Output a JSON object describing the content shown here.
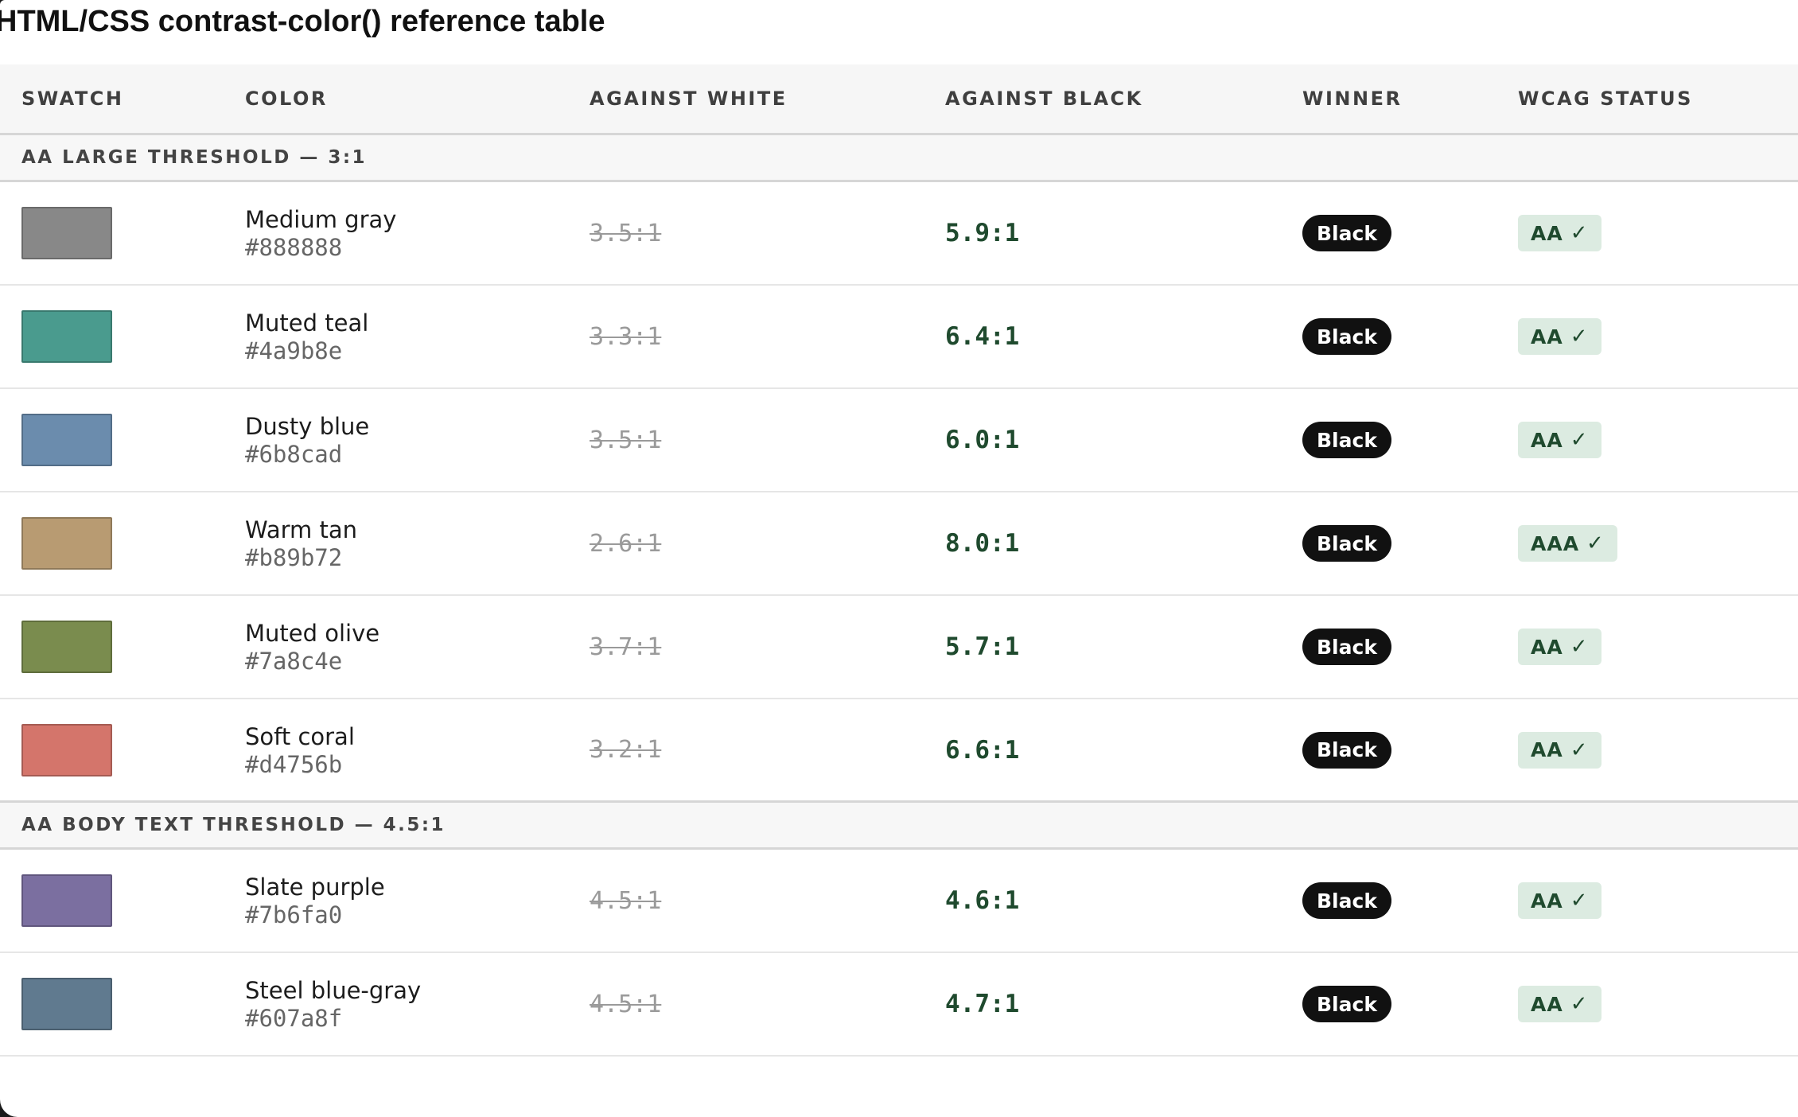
{
  "page": {
    "title": "HTML/CSS contrast-color() reference table"
  },
  "table": {
    "headers": {
      "swatch": "SWATCH",
      "color": "COLOR",
      "against_white": "AGAINST WHITE",
      "against_black": "AGAINST BLACK",
      "winner": "WINNER",
      "wcag_status": "WCAG STATUS"
    },
    "groups": [
      {
        "label": "AA LARGE THRESHOLD — 3:1",
        "rows": [
          {
            "name": "Medium gray",
            "hex": "#888888",
            "swatch_color": "#888888",
            "against_white": "3.5:1",
            "against_black": "5.9:1",
            "winner": "Black",
            "status": "AA",
            "status_icon": "✓"
          },
          {
            "name": "Muted teal",
            "hex": "#4a9b8e",
            "swatch_color": "#4a9b8e",
            "against_white": "3.3:1",
            "against_black": "6.4:1",
            "winner": "Black",
            "status": "AA",
            "status_icon": "✓"
          },
          {
            "name": "Dusty blue",
            "hex": "#6b8cad",
            "swatch_color": "#6b8cad",
            "against_white": "3.5:1",
            "against_black": "6.0:1",
            "winner": "Black",
            "status": "AA",
            "status_icon": "✓"
          },
          {
            "name": "Warm tan",
            "hex": "#b89b72",
            "swatch_color": "#b89b72",
            "against_white": "2.6:1",
            "against_black": "8.0:1",
            "winner": "Black",
            "status": "AAA",
            "status_icon": "✓"
          },
          {
            "name": "Muted olive",
            "hex": "#7a8c4e",
            "swatch_color": "#7a8c4e",
            "against_white": "3.7:1",
            "against_black": "5.7:1",
            "winner": "Black",
            "status": "AA",
            "status_icon": "✓"
          },
          {
            "name": "Soft coral",
            "hex": "#d4756b",
            "swatch_color": "#d4756b",
            "against_white": "3.2:1",
            "against_black": "6.6:1",
            "winner": "Black",
            "status": "AA",
            "status_icon": "✓"
          }
        ]
      },
      {
        "label": "AA BODY TEXT THRESHOLD — 4.5:1",
        "rows": [
          {
            "name": "Slate purple",
            "hex": "#7b6fa0",
            "swatch_color": "#7b6fa0",
            "against_white": "4.5:1",
            "against_black": "4.6:1",
            "winner": "Black",
            "status": "AA",
            "status_icon": "✓"
          },
          {
            "name": "Steel blue-gray",
            "hex": "#607a8f",
            "swatch_color": "#607a8f",
            "against_white": "4.5:1",
            "against_black": "4.7:1",
            "winner": "Black",
            "status": "AA",
            "status_icon": "✓"
          }
        ]
      }
    ]
  },
  "colors": {
    "pass_text": "#1f4a2e",
    "pass_badge_bg": "#dcebe1",
    "fail_text": "#9a9a9a",
    "winner_pill_bg": "#111111"
  }
}
